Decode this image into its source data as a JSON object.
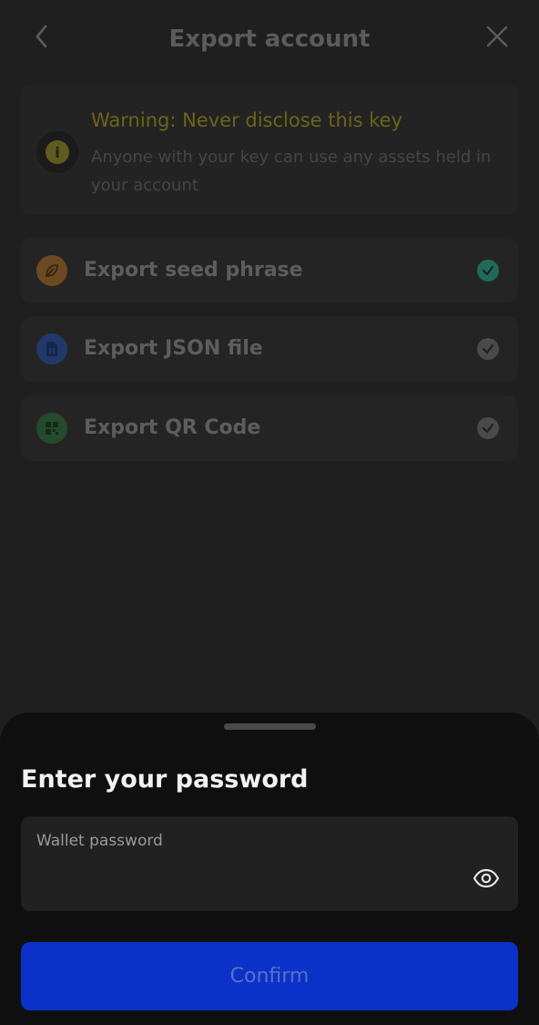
{
  "header": {
    "title": "Export account",
    "back_icon": "chevron-left-icon",
    "close_icon": "close-icon"
  },
  "warning": {
    "icon": "info-icon",
    "title": "Warning: Never disclose this key",
    "body": "Anyone with your key can use any assets held in your account"
  },
  "options": [
    {
      "label": "Export seed phrase",
      "icon": "leaf-icon",
      "icon_color": "#6b4a22",
      "checked": true,
      "check_color": "#1f6b58"
    },
    {
      "label": "Export JSON file",
      "icon": "file-json-icon",
      "icon_color": "#22386a",
      "checked": false,
      "check_color": "#4a4a4a"
    },
    {
      "label": "Export QR Code",
      "icon": "qr-code-icon",
      "icon_color": "#244a2c",
      "checked": false,
      "check_color": "#4a4a4a"
    }
  ],
  "sheet": {
    "title": "Enter your password",
    "password_label": "Wallet password",
    "password_value": "",
    "eye_icon": "eye-icon",
    "confirm_label": "Confirm"
  },
  "colors": {
    "accent": "#0a32c8",
    "warning_text": "#6b6419"
  }
}
